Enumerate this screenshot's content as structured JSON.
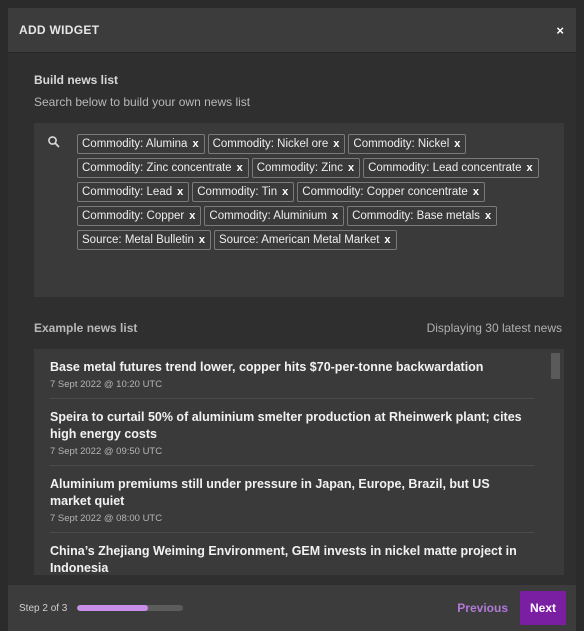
{
  "modal": {
    "title": "ADD WIDGET",
    "close_label": "×"
  },
  "build": {
    "title": "Build news list",
    "subtitle": "Search below to build your own news list",
    "tags": [
      "Commodity: Alumina",
      "Commodity: Nickel ore",
      "Commodity: Nickel",
      "Commodity: Zinc concentrate",
      "Commodity: Zinc",
      "Commodity: Lead concentrate",
      "Commodity: Lead",
      "Commodity: Tin",
      "Commodity: Copper concentrate",
      "Commodity: Copper",
      "Commodity: Aluminium",
      "Commodity: Base metals",
      "Source: Metal Bulletin",
      "Source: American Metal Market"
    ],
    "tag_remove_glyph": "x"
  },
  "example": {
    "title": "Example news list",
    "count_text": "Displaying 30 latest news",
    "items": [
      {
        "title": "Base metal futures trend lower, copper hits $70-per-tonne backwardation",
        "date": "7 Sept 2022 @ 10:20 UTC"
      },
      {
        "title": "Speira to curtail 50% of aluminium smelter production at Rheinwerk plant; cites high energy costs",
        "date": "7 Sept 2022 @ 09:50 UTC"
      },
      {
        "title": "Aluminium premiums still under pressure in Japan, Europe, Brazil, but US market quiet",
        "date": "7 Sept 2022 @ 08:00 UTC"
      },
      {
        "title": "China’s Zhejiang Weiming Environment, GEM invests in nickel matte project in Indonesia",
        "date": ""
      }
    ]
  },
  "footer": {
    "step_label": "Step 2 of 3",
    "progress_fraction": 0.667,
    "previous_label": "Previous",
    "next_label": "Next"
  },
  "colors": {
    "accent": "#7a1fa2",
    "progress": "#c98ee8",
    "previous_text": "#b07ad6"
  },
  "icons": {
    "search": "search-icon",
    "close": "close-icon",
    "tag_remove": "remove-tag-icon"
  }
}
